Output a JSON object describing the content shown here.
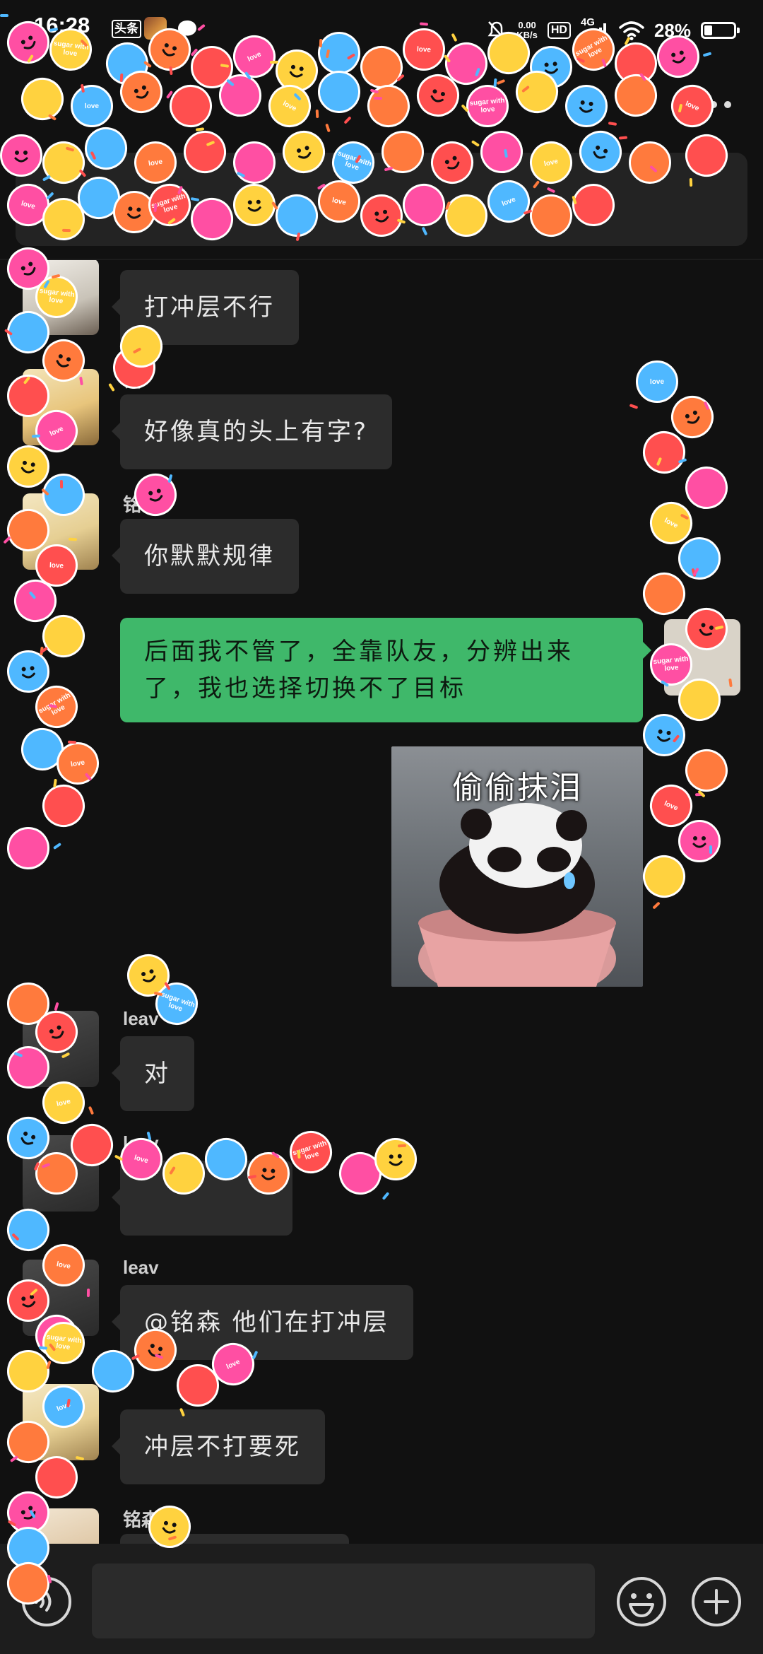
{
  "status_bar": {
    "time": "16:28",
    "app_badge": "头条",
    "net_speed_value": "0.00",
    "net_speed_unit": "KB/s",
    "hd": "HD",
    "network": "4G",
    "battery": "28%",
    "battery_level": 0.28
  },
  "messages": [
    {
      "sender": "",
      "text": "打冲层不行"
    },
    {
      "sender": "铭",
      "text": "好像真的头上有字?"
    },
    {
      "sender": "铭",
      "text": "你默默规律"
    },
    {
      "sender": "",
      "text": "后面我不管了，全靠队友，分辨出来了，我也选择切换不了目标"
    },
    {
      "sender": "",
      "sticker_caption": "偷偷抹泪"
    },
    {
      "sender": "leav",
      "text": "对"
    },
    {
      "sender": "leav",
      "text": ""
    },
    {
      "sender": "leav",
      "text": "@铭森  他们在打冲层"
    },
    {
      "sender": "",
      "text": "冲层不打要死"
    },
    {
      "sender": "铭森",
      "text": ""
    }
  ],
  "confetti": {
    "labels": [
      "love",
      "sugar with love",
      "love"
    ],
    "colors": [
      "#ff4fa3",
      "#ffd23f",
      "#4fb8ff",
      "#ff7a3d",
      "#ff4f4f"
    ]
  },
  "input": {
    "value": "",
    "placeholder": ""
  },
  "icons": {
    "back": "chevron-left-icon",
    "more": "more-dots-icon",
    "voice": "voice-icon",
    "emoji": "emoji-icon",
    "plus": "plus-icon"
  }
}
